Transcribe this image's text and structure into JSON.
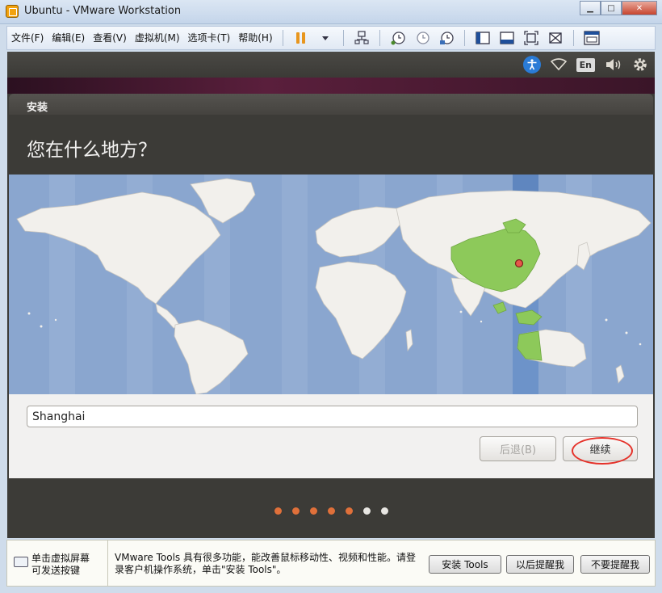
{
  "window": {
    "title": "Ubuntu - VMware Workstation"
  },
  "menu": [
    "文件(F)",
    "编辑(E)",
    "查看(V)",
    "虚拟机(M)",
    "选项卡(T)",
    "帮助(H)"
  ],
  "panel": {
    "keyboard_layout": "En"
  },
  "installer": {
    "label": "安装",
    "question": "您在什么地方？",
    "location_value": "Shanghai",
    "back_label": "后退(B)",
    "continue_label": "继续",
    "progress": {
      "total": 7,
      "completed": 5
    }
  },
  "tools_bar": {
    "hint": "单击虚拟屏幕\n可发送按键",
    "message": "VMware Tools 具有很多功能，能改善鼠标移动性、视频和性能。请登录客户机操作系统，单击\"安装 Tools\"。",
    "install_label": "安装 Tools",
    "remind_later_label": "以后提醒我",
    "never_remind_label": "不要提醒我"
  },
  "colors": {
    "ubuntu_orange": "#e0703a",
    "ocean": "#8aa6cf",
    "selected_zone": "#6d93c9",
    "land": "#f2f0ec",
    "highlight_land": "#8dc95a",
    "annotation_red": "#e5322a"
  }
}
